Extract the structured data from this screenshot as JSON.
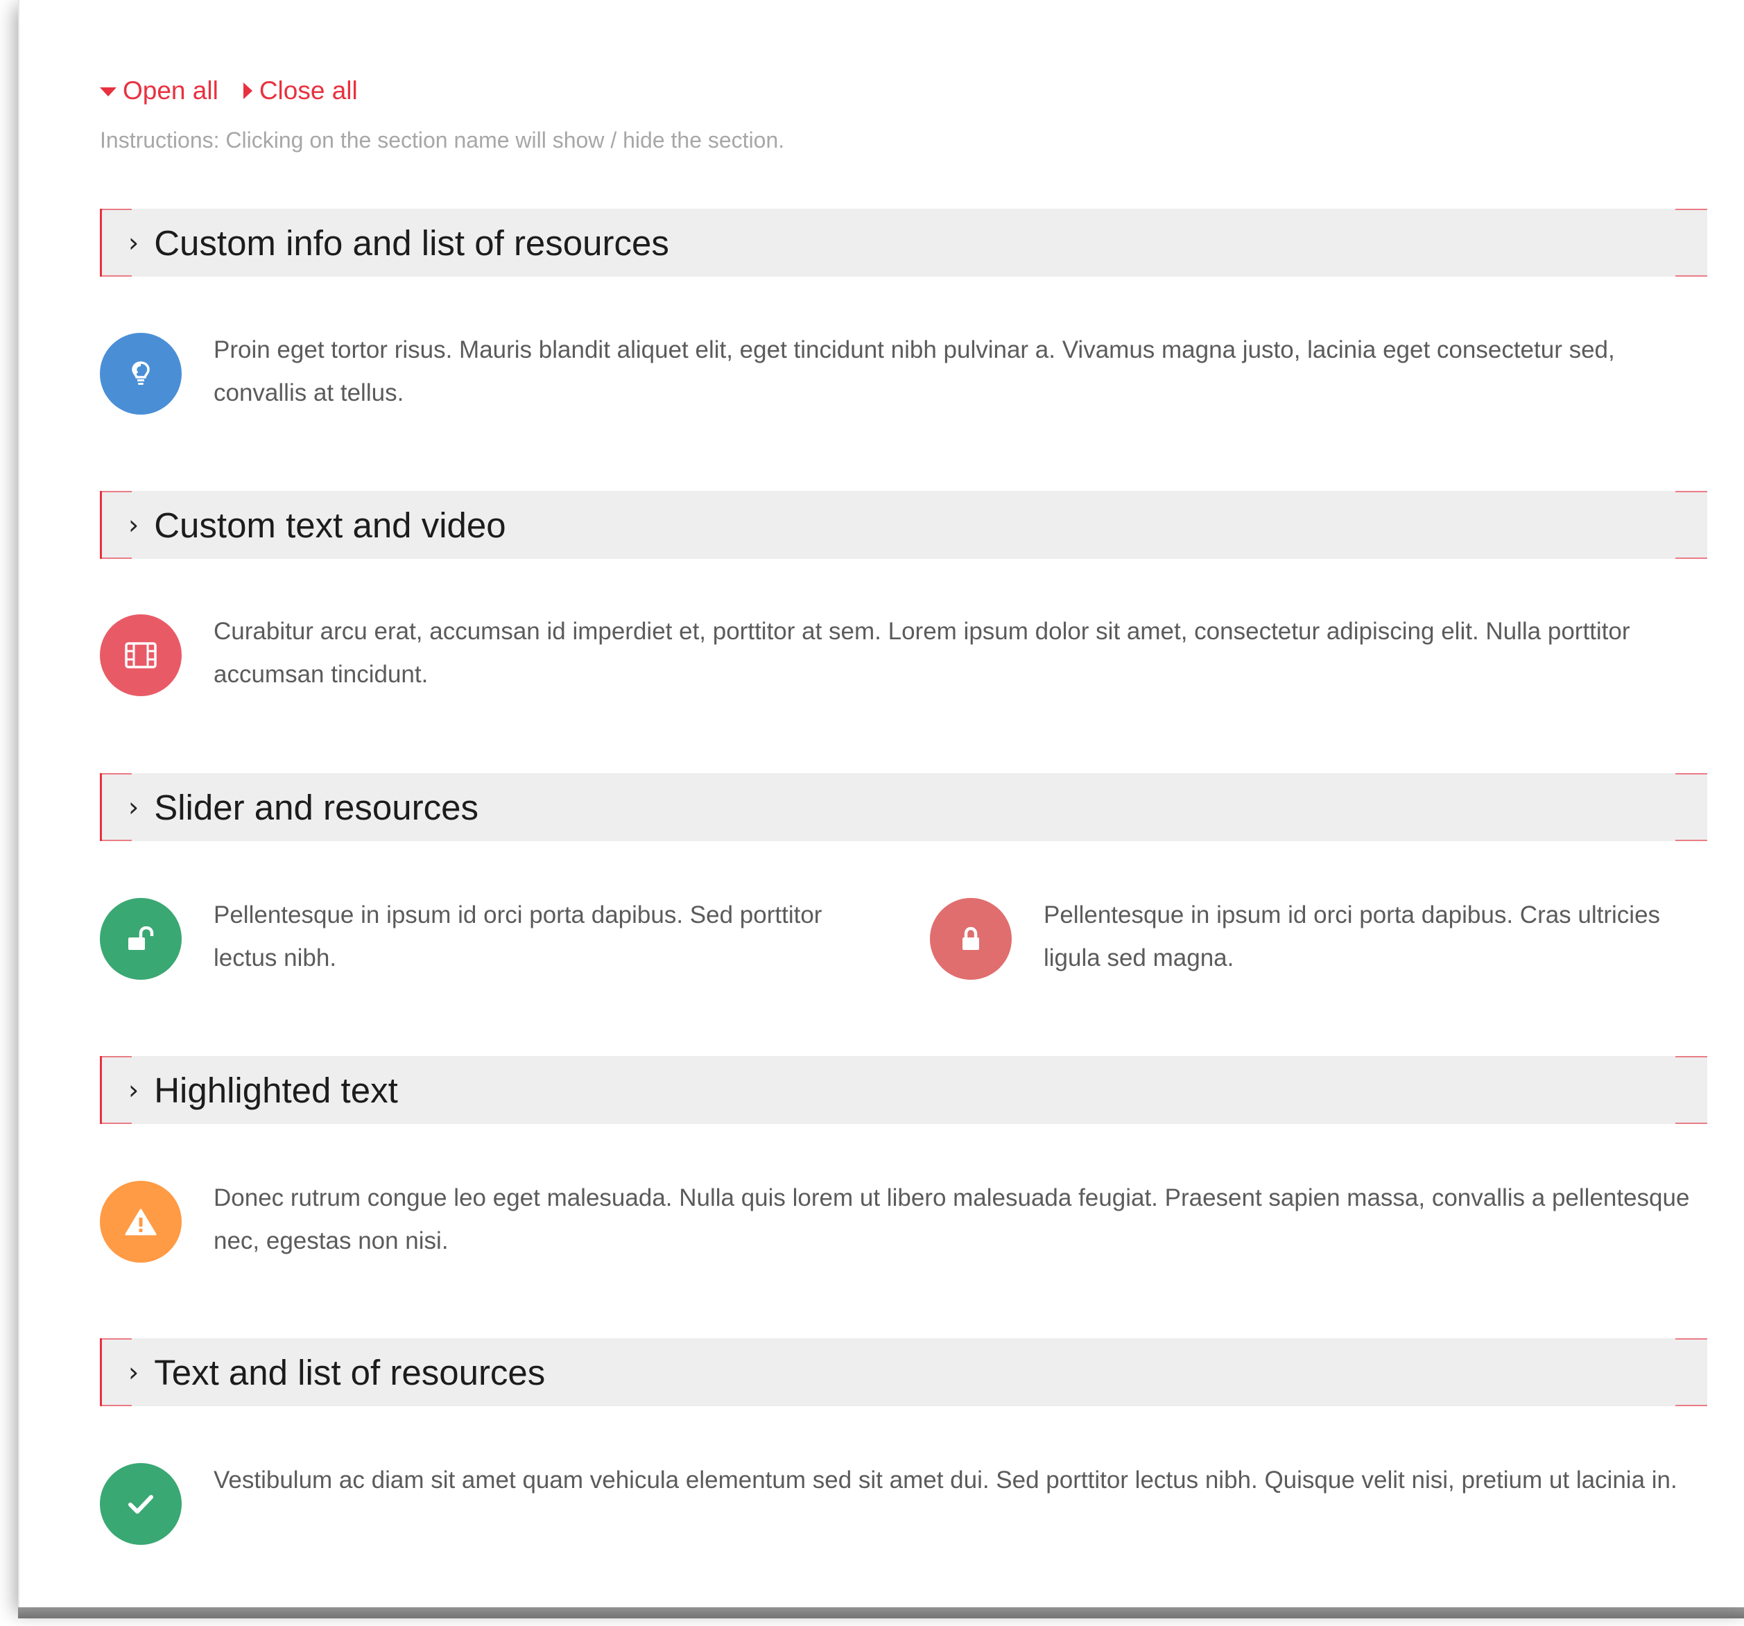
{
  "controls": {
    "open_all": "Open all",
    "close_all": "Close all",
    "accent_color": "#e8313f"
  },
  "instructions": "Instructions: Clicking on the section name will show / hide the section.",
  "sections": [
    {
      "title": "Custom info and list of resources",
      "items": [
        {
          "icon": "lightbulb-icon",
          "color": "#4a8fd6",
          "text": "Proin eget tortor risus. Mauris blandit aliquet elit, eget tincidunt nibh pulvinar a. Vivamus magna justo, lacinia eget consectetur sed, convallis at tellus."
        }
      ]
    },
    {
      "title": "Custom text and video",
      "items": [
        {
          "icon": "film-icon",
          "color": "#e95a67",
          "text": "Curabitur arcu erat, accumsan id imperdiet et, porttitor at sem. Lorem ipsum dolor sit amet, consectetur adipiscing elit. Nulla porttitor accumsan tincidunt."
        }
      ]
    },
    {
      "title": "Slider and resources",
      "items": [
        {
          "icon": "unlock-icon",
          "color": "#3aa873",
          "text": "Pellentesque in ipsum id orci porta dapibus. Sed porttitor lectus nibh."
        },
        {
          "icon": "lock-icon",
          "color": "#e06e6e",
          "text": "Pellentesque in ipsum id orci porta dapibus. Cras ultricies ligula sed magna."
        }
      ]
    },
    {
      "title": "Highlighted text",
      "items": [
        {
          "icon": "warning-icon",
          "color": "#ff9a45",
          "text": "Donec rutrum congue leo eget malesuada. Nulla quis lorem ut libero malesuada feugiat. Praesent sapien massa, convallis a pellentesque nec, egestas non nisi."
        }
      ]
    },
    {
      "title": "Text and list of resources",
      "items": [
        {
          "icon": "checkmark-icon",
          "color": "#3aa873",
          "text": "Vestibulum ac diam sit amet quam vehicula elementum sed sit amet dui. Sed porttitor lectus nibh. Quisque velit nisi, pretium ut lacinia in."
        }
      ]
    }
  ]
}
